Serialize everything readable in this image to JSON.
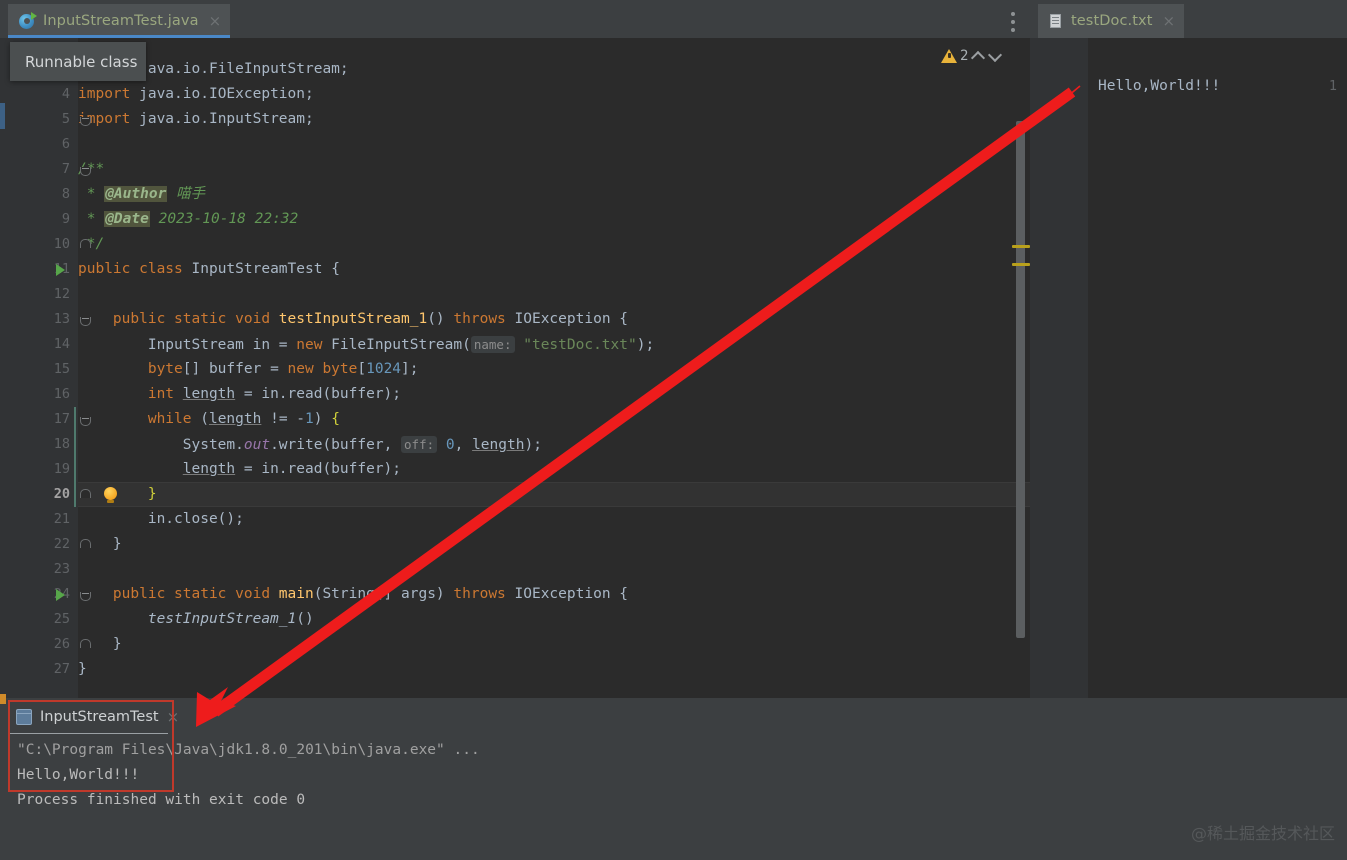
{
  "window": {
    "watermark": "@稀土掘金技术社区"
  },
  "editor_tabs": {
    "left": [
      {
        "label": "InputStreamTest.java",
        "icon": "java-class-icon",
        "close": "×",
        "active": true
      }
    ],
    "right": [
      {
        "label": "testDoc.txt",
        "icon": "text-file-icon",
        "close": "×",
        "active": true
      }
    ],
    "more_options_icon": "more-vertical-icon"
  },
  "tooltip": {
    "text": "Runnable class"
  },
  "inspections": {
    "warning_icon": "warning-triangle-icon",
    "count": "2",
    "prev_icon": "chevron-up-icon",
    "next_icon": "chevron-down-icon"
  },
  "code": {
    "first_visible_line": 3,
    "current_line": 20,
    "lines": [
      {
        "n": 3,
        "html": "<span class='kw'>import</span> java.io.FileInputStream;"
      },
      {
        "n": 4,
        "html": "<span class='kw'>import</span> java.io.IOException;"
      },
      {
        "n": 5,
        "html": "<span class='kw'>import</span> java.io.InputStream;"
      },
      {
        "n": 6,
        "html": ""
      },
      {
        "n": 7,
        "html": "<span class='cmt'>/**</span>"
      },
      {
        "n": 8,
        "html": "<span class='cmt'> * </span><span class='tag'>@Author</span><span class='cmt'> 喵手</span>"
      },
      {
        "n": 9,
        "html": "<span class='cmt'> * </span><span class='tag'>@Date</span><span class='cmt'> 2023-10-18 22:32</span>"
      },
      {
        "n": 10,
        "html": "<span class='cmt'> */</span>"
      },
      {
        "n": 11,
        "html": "<span class='kw'>public class </span><span>InputStreamTest </span>{"
      },
      {
        "n": 12,
        "html": ""
      },
      {
        "n": 13,
        "html": "    <span class='kw'>public static void </span><span class='fn'>testInputStream_1</span>() <span class='kw'>throws </span>IOException {"
      },
      {
        "n": 14,
        "html": "        InputStream in = <span class='kw'>new </span>FileInputStream(<span class='hint'>name:</span> <span class='str'>\"testDoc.txt\"</span>);"
      },
      {
        "n": 15,
        "html": "        <span class='kw'>byte</span>[] buffer = <span class='kw'>new byte</span>[<span class='num'>1024</span>];"
      },
      {
        "n": 16,
        "html": "        <span class='kw'>int </span><span class='ul'>length</span> = in.read(buffer);"
      },
      {
        "n": 17,
        "html": "        <span class='kw'>while </span>(<span class='ul'>length</span> != -<span class='num'>1</span>) <span class='br'>{</span>"
      },
      {
        "n": 18,
        "html": "            System.<span class='fld'>out</span>.write(buffer, <span class='hint'>off:</span> <span class='num'>0</span>, <span class='ul'>length</span>);"
      },
      {
        "n": 19,
        "html": "            <span class='ul'>length</span> = in.read(buffer);"
      },
      {
        "n": 20,
        "html": "        <span class='br'>}</span>"
      },
      {
        "n": 21,
        "html": "        in.close();"
      },
      {
        "n": 22,
        "html": "    }"
      },
      {
        "n": 23,
        "html": ""
      },
      {
        "n": 24,
        "html": "    <span class='kw'>public static void </span><span class='fn'>main</span>(String[] args) <span class='kw'>throws </span>IOException {"
      },
      {
        "n": 25,
        "html": "        <span class='it'>testInputStream_1</span>()"
      },
      {
        "n": 26,
        "html": "    }"
      },
      {
        "n": 27,
        "html": "}"
      }
    ],
    "run_marker_lines": [
      11,
      24
    ],
    "bulb_line": 20
  },
  "right_editor": {
    "line_number": "1",
    "content": "Hello,World!!!"
  },
  "console": {
    "tab_label": "InputStreamTest",
    "tab_icon": "run-console-icon",
    "tab_close": "×",
    "lines": [
      {
        "text": "\"C:\\Program Files\\Java\\jdk1.8.0_201\\bin\\java.exe\" ...",
        "dim": true
      },
      {
        "text": "Hello,World!!!",
        "dim": false
      },
      {
        "text": "Process finished with exit code 0",
        "dim": false
      }
    ]
  },
  "annotations": {
    "arrow_color": "#ee1c1c",
    "box_color": "#c0392b"
  }
}
